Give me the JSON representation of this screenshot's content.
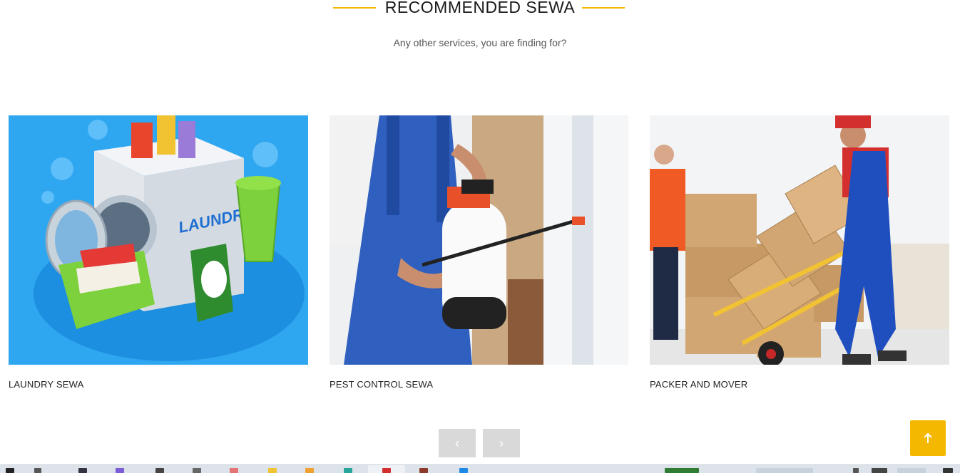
{
  "section": {
    "title": "RECOMMENDED SEWA",
    "subtitle": "Any other services, you are finding for?"
  },
  "cards": [
    {
      "caption": "LAUNDRY SEWA",
      "image_label": "LAUNDRY",
      "image_icon": "laundry-illustration"
    },
    {
      "caption": "PEST CONTROL SEWA",
      "image_icon": "pest-control-photo"
    },
    {
      "caption": "PACKER AND MOVER",
      "image_icon": "movers-photo"
    }
  ],
  "carousel": {
    "prev_icon": "chevron-left-icon",
    "prev_glyph": "‹",
    "next_icon": "chevron-right-icon",
    "next_glyph": "›"
  },
  "scroll_top": {
    "icon": "arrow-up-icon"
  },
  "colors": {
    "accent": "#f5b800",
    "nav_button": "#d9d9d9",
    "laundry_bg": "#2ea6f0"
  }
}
